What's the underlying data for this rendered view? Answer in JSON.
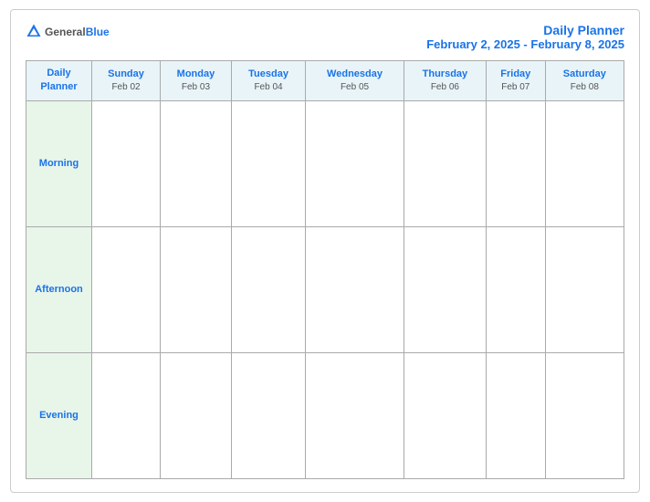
{
  "logo": {
    "general": "General",
    "blue": "Blue"
  },
  "title": {
    "main": "Daily Planner",
    "date_range": "February 2, 2025 - February 8, 2025"
  },
  "columns": [
    {
      "id": "planner",
      "day_name": "Daily",
      "day_name2": "Planner",
      "date": ""
    },
    {
      "id": "sun",
      "day_name": "Sunday",
      "date": "Feb 02"
    },
    {
      "id": "mon",
      "day_name": "Monday",
      "date": "Feb 03"
    },
    {
      "id": "tue",
      "day_name": "Tuesday",
      "date": "Feb 04"
    },
    {
      "id": "wed",
      "day_name": "Wednesday",
      "date": "Feb 05"
    },
    {
      "id": "thu",
      "day_name": "Thursday",
      "date": "Feb 06"
    },
    {
      "id": "fri",
      "day_name": "Friday",
      "date": "Feb 07"
    },
    {
      "id": "sat",
      "day_name": "Saturday",
      "date": "Feb 08"
    }
  ],
  "rows": [
    {
      "id": "morning",
      "label": "Morning"
    },
    {
      "id": "afternoon",
      "label": "Afternoon"
    },
    {
      "id": "evening",
      "label": "Evening"
    }
  ]
}
